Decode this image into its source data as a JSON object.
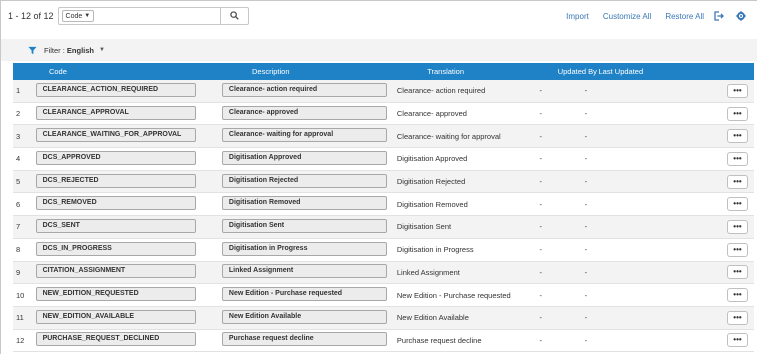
{
  "toolbar": {
    "count": "1 - 12 of 12",
    "scope_label": "Code",
    "search_value": "",
    "search_placeholder": "",
    "import_label": "Import",
    "customize_all_label": "Customize All",
    "restore_all_label": "Restore All"
  },
  "filter": {
    "label": "Filter : ",
    "value": "English"
  },
  "table": {
    "headers": {
      "code": "Code",
      "description": "Description",
      "translation": "Translation",
      "updated_by": "Updated By",
      "last_updated": "Last Updated"
    },
    "rows": [
      {
        "num": "1",
        "code": "CLEARANCE_ACTION_REQUIRED",
        "description": "Clearance- action required",
        "translation": "Clearance- action required",
        "updated_by": "-",
        "last_updated": "-"
      },
      {
        "num": "2",
        "code": "CLEARANCE_APPROVAL",
        "description": "Clearance- approved",
        "translation": "Clearance- approved",
        "updated_by": "-",
        "last_updated": "-"
      },
      {
        "num": "3",
        "code": "CLEARANCE_WAITING_FOR_APPROVAL",
        "description": "Clearance- waiting for approval",
        "translation": "Clearance- waiting for approval",
        "updated_by": "-",
        "last_updated": "-"
      },
      {
        "num": "4",
        "code": "DCS_APPROVED",
        "description": "Digitisation Approved",
        "translation": "Digitisation Approved",
        "updated_by": "-",
        "last_updated": "-"
      },
      {
        "num": "5",
        "code": "DCS_REJECTED",
        "description": "Digitisation Rejected",
        "translation": "Digitisation Rejected",
        "updated_by": "-",
        "last_updated": "-"
      },
      {
        "num": "6",
        "code": "DCS_REMOVED",
        "description": "Digitisation Removed",
        "translation": "Digitisation Removed",
        "updated_by": "-",
        "last_updated": "-"
      },
      {
        "num": "7",
        "code": "DCS_SENT",
        "description": "Digitisation Sent",
        "translation": "Digitisation Sent",
        "updated_by": "-",
        "last_updated": "-"
      },
      {
        "num": "8",
        "code": "DCS_IN_PROGRESS",
        "description": "Digitisation in Progress",
        "translation": "Digitisation in Progress",
        "updated_by": "-",
        "last_updated": "-"
      },
      {
        "num": "9",
        "code": "CITATION_ASSIGNMENT",
        "description": "Linked Assignment",
        "translation": "Linked Assignment",
        "updated_by": "-",
        "last_updated": "-"
      },
      {
        "num": "10",
        "code": "NEW_EDITION_REQUESTED",
        "description": "New Edition - Purchase requested",
        "translation": "New Edition - Purchase requested",
        "updated_by": "-",
        "last_updated": "-"
      },
      {
        "num": "11",
        "code": "NEW_EDITION_AVAILABLE",
        "description": "New Edition Available",
        "translation": "New Edition Available",
        "updated_by": "-",
        "last_updated": "-"
      },
      {
        "num": "12",
        "code": "PURCHASE_REQUEST_DECLINED",
        "description": "Purchase request decline",
        "translation": "Purchase request decline",
        "updated_by": "-",
        "last_updated": "-"
      }
    ],
    "row_action_label": "•••"
  },
  "icons": {
    "caret": "caret-down-icon",
    "search": "search-icon",
    "export": "export-icon",
    "settings": "gear-icon",
    "filter": "filter-icon"
  },
  "colors": {
    "header_bg": "#1f82c6",
    "link": "#3a78b5",
    "filter_bg": "#f3f3f3"
  }
}
